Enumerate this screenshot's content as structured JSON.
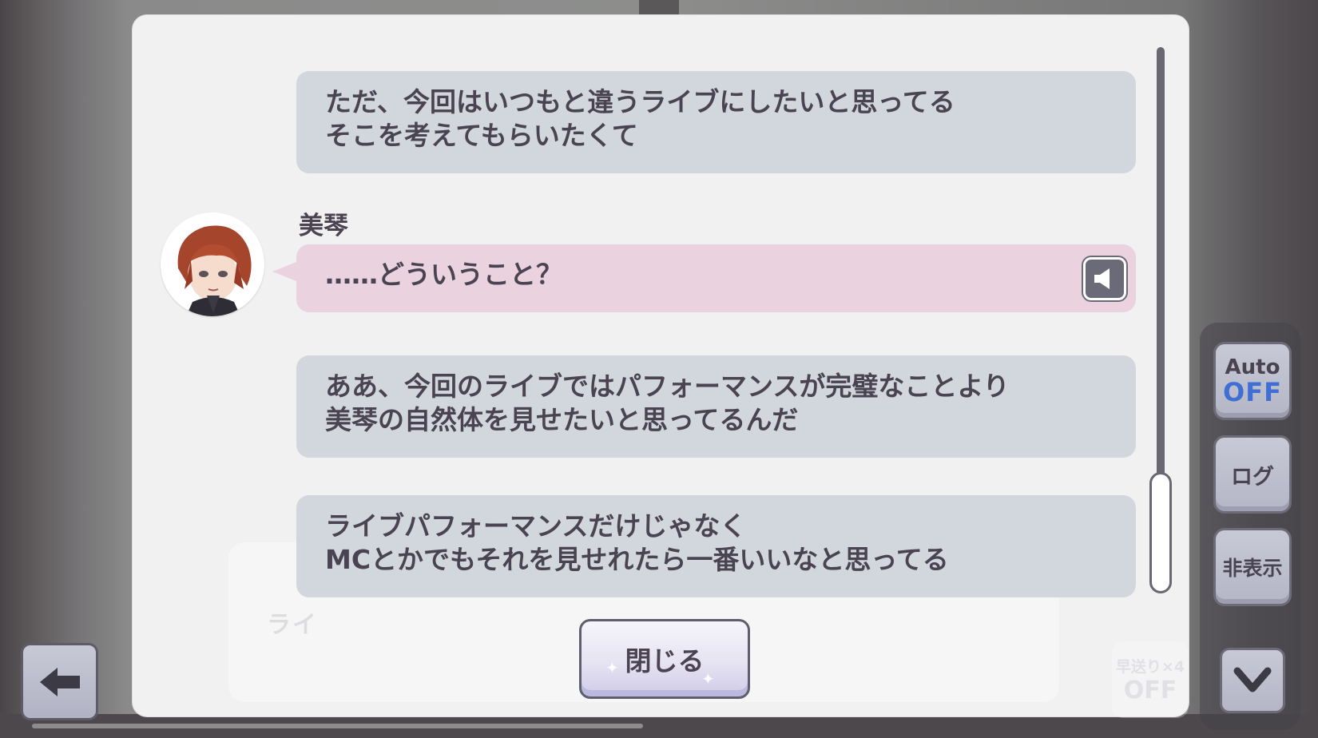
{
  "log_panel": {
    "entries": [
      {
        "lines": [
          "ただ、今回はいつもと違うライブにしたいと思ってる",
          "そこを考えてもらいたくて"
        ]
      },
      {
        "speaker": "美琴",
        "lines": [
          "……どういうこと？"
        ],
        "has_voice": true
      },
      {
        "lines": [
          "ああ、今回のライブではパフォーマンスが完璧なことより",
          "美琴の自然体を見せたいと思ってるんだ"
        ]
      },
      {
        "lines": [
          "ライブパフォーマンスだけじゃなく",
          "MCとかでもそれを見せれたら一番いいなと思ってる"
        ]
      }
    ],
    "close_label": "閉じる",
    "background_ghost_text": "ライ"
  },
  "controls": {
    "auto_label": "Auto",
    "auto_state": "OFF",
    "log_label": "ログ",
    "hide_label": "非表示",
    "fast_forward_label": "早送り×4",
    "fast_forward_state": "OFF"
  },
  "icons": {
    "back": "arrow-left-icon",
    "voice": "speaker-icon",
    "down": "chevron-down-icon"
  },
  "colors": {
    "bubble": "#d2d7dd",
    "speaker_bubble": "#ead3df",
    "text": "#4a4452",
    "auto_off": "#3f6fd4"
  }
}
